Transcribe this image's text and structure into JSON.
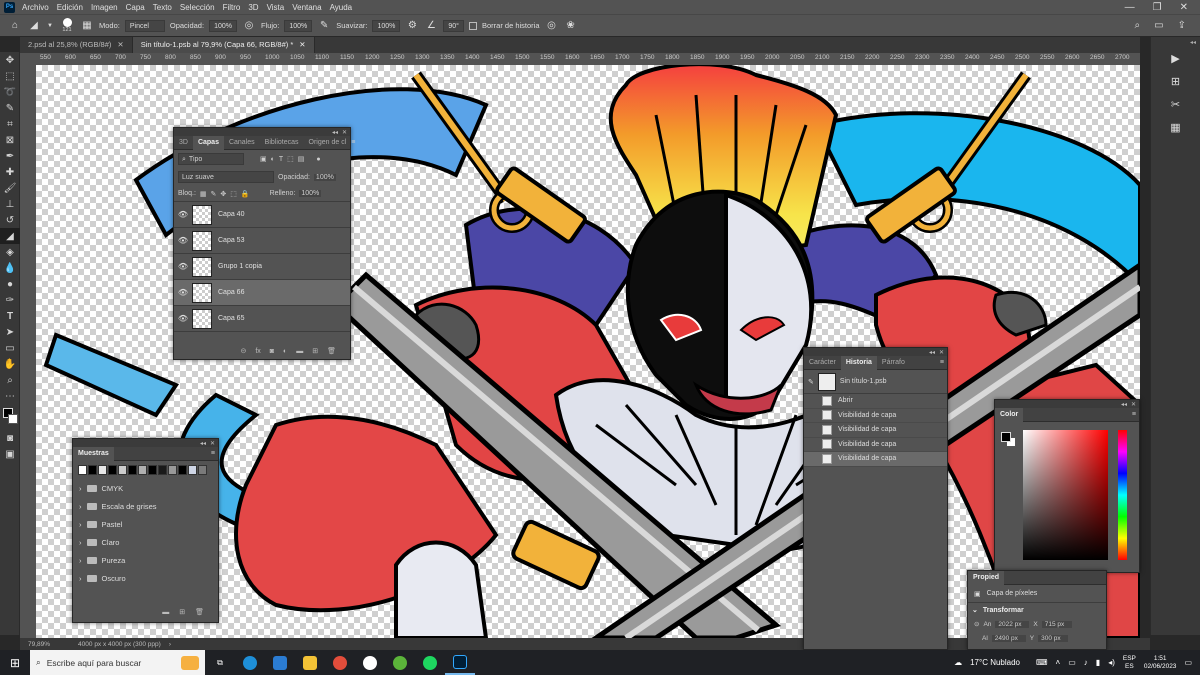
{
  "menubar": {
    "app_icon": "Ps",
    "items": [
      "Archivo",
      "Edición",
      "Imagen",
      "Capa",
      "Texto",
      "Selección",
      "Filtro",
      "3D",
      "Vista",
      "Ventana",
      "Ayuda"
    ]
  },
  "options_bar": {
    "brush_size": "121",
    "modo_label": "Modo:",
    "modo_value": "Pincel",
    "opacidad_label": "Opacidad:",
    "opacidad_value": "100%",
    "flujo_label": "Flujo:",
    "flujo_value": "100%",
    "suavizar_label": "Suavizar:",
    "suavizar_value": "100%",
    "angle_value": "90°",
    "borrar_label": "Borrar de historia"
  },
  "tabs": [
    {
      "label": "2.psd al 25,8% (RGB/8#)"
    },
    {
      "label": "Sin título-1.psb al 79,9% (Capa 66, RGB/8#) *"
    }
  ],
  "ruler_h": [
    "550",
    "600",
    "650",
    "700",
    "750",
    "800",
    "850",
    "900",
    "950",
    "1000",
    "1050",
    "1100",
    "1150",
    "1200",
    "1250",
    "1300",
    "1350",
    "1400",
    "1450",
    "1500",
    "1550",
    "1600",
    "1650",
    "1700",
    "1750",
    "1800",
    "1850",
    "1900",
    "1950",
    "2000",
    "2050",
    "2100",
    "2150",
    "2200",
    "2250",
    "2300",
    "2350",
    "2400",
    "2450",
    "2500",
    "2550",
    "2600",
    "2650",
    "2700"
  ],
  "status": {
    "zoom": "79,89%",
    "doc_info": "4000 px x 4000 px (300 ppp)"
  },
  "layers_panel": {
    "tabs": [
      "3D",
      "Capas",
      "Canales",
      "Bibliotecas",
      "Origen de cl"
    ],
    "filter": "Tipo",
    "blend_mode": "Luz suave",
    "opacidad_label": "Opacidad:",
    "opacidad_value": "100%",
    "bloq_label": "Bloq.:",
    "relleno_label": "Relleno:",
    "relleno_value": "100%",
    "layers": [
      {
        "name": "Capa 40"
      },
      {
        "name": "Capa 53"
      },
      {
        "name": "Grupo 1 copia"
      },
      {
        "name": "Capa 66"
      },
      {
        "name": "Capa 65"
      }
    ]
  },
  "swatches_panel": {
    "title": "Muestras",
    "swatch_colors": [
      "#ffffff",
      "#000000",
      "#e8e8e8",
      "#000000",
      "#cccccc",
      "#000000",
      "#b0b0b0",
      "#000000",
      "#1a1a1a",
      "#999999",
      "#000000",
      "#cfd6e6",
      "#7a7a7a"
    ],
    "folders": [
      "CMYK",
      "Escala de grises",
      "Pastel",
      "Claro",
      "Pureza",
      "Oscuro"
    ]
  },
  "history_panel": {
    "tabs": [
      "Carácter",
      "Historia",
      "Párrafo"
    ],
    "snapshot": "Sin título-1.psb",
    "items": [
      "Abrir",
      "Visibilidad de capa",
      "Visibilidad de capa",
      "Visibilidad de capa",
      "Visibilidad de capa"
    ]
  },
  "color_panel": {
    "title": "Color",
    "hue_color": "#ff0000"
  },
  "properties_panel": {
    "title": "Propied",
    "type": "Capa de píxeles",
    "transform_label": "Transformar",
    "w_label": "An",
    "w_value": "2022 px",
    "x_label": "X",
    "x_value": "715 px",
    "h_label": "Al",
    "h_value": "2490 px",
    "y_label": "Y",
    "y_value": "300 px"
  },
  "taskbar": {
    "search_placeholder": "Escribe aquí para buscar",
    "weather": "17°C  Nublado",
    "lang_1": "ESP",
    "lang_2": "ES",
    "time": "1:51",
    "date": "02/06/2023"
  }
}
